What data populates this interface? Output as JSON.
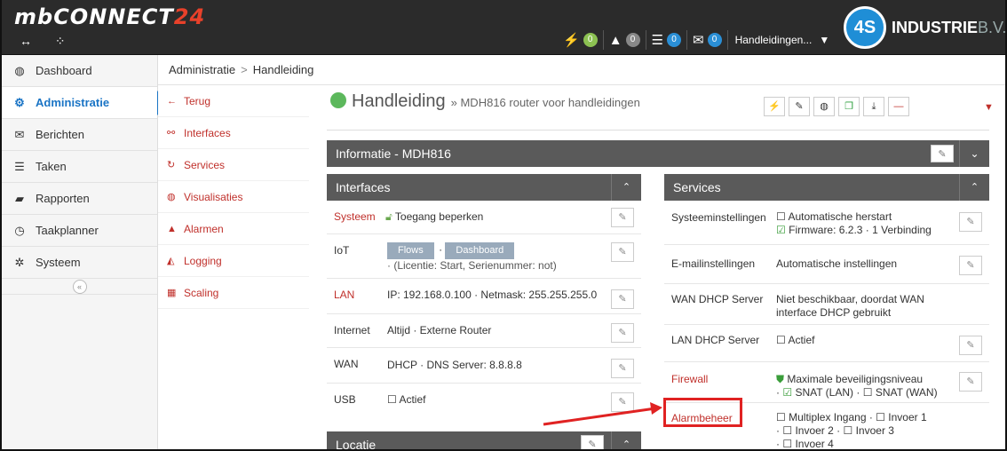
{
  "header": {
    "logo_main": "mbCONNECT",
    "logo_num": "24",
    "left_icons": [
      "arrows-icon",
      "spinner-icon"
    ],
    "badges": [
      {
        "icon": "bolt-icon",
        "glyph": "⚡",
        "count": "0",
        "color": "#8cc152"
      },
      {
        "icon": "warning-icon",
        "glyph": "▲",
        "count": "0",
        "color": "#888888"
      },
      {
        "icon": "server-icon",
        "glyph": "☰",
        "count": "0",
        "color": "#2a8fd6"
      },
      {
        "icon": "mail-icon",
        "glyph": "✉",
        "count": "0",
        "color": "#2a8fd6"
      }
    ],
    "user": "Handleidingen...",
    "brand_circle": "4S",
    "brand_name": "INDUSTRIE",
    "brand_suffix": "B.V."
  },
  "leftnav": {
    "items": [
      {
        "label": "Dashboard",
        "icon": "dashboard-icon",
        "glyph": "◍"
      },
      {
        "label": "Administratie",
        "icon": "cogs-icon",
        "glyph": "⚙"
      },
      {
        "label": "Berichten",
        "icon": "envelope-icon",
        "glyph": "✉"
      },
      {
        "label": "Taken",
        "icon": "server-icon",
        "glyph": "☰"
      },
      {
        "label": "Rapporten",
        "icon": "book-icon",
        "glyph": "▰"
      },
      {
        "label": "Taakplanner",
        "icon": "clock-icon",
        "glyph": "◷"
      },
      {
        "label": "Systeem",
        "icon": "gear-icon",
        "glyph": "✲"
      }
    ],
    "collapse": "«"
  },
  "breadcrumb": {
    "first": "Administratie",
    "sep": ">",
    "second": "Handleiding"
  },
  "subnav": {
    "items": [
      {
        "label": "Terug",
        "icon": "arrow-left-icon",
        "glyph": "←"
      },
      {
        "label": "Interfaces",
        "icon": "sitemap-icon",
        "glyph": "⚯"
      },
      {
        "label": "Services",
        "icon": "refresh-icon",
        "glyph": "↻"
      },
      {
        "label": "Visualisaties",
        "icon": "dashboard-icon",
        "glyph": "◍"
      },
      {
        "label": "Alarmen",
        "icon": "warning-icon",
        "glyph": "▲"
      },
      {
        "label": "Logging",
        "icon": "area-chart-icon",
        "glyph": "◭"
      },
      {
        "label": "Scaling",
        "icon": "calculator-icon",
        "glyph": "▦"
      }
    ]
  },
  "title": {
    "main": "Handleiding",
    "sub": "» MDH816 router voor handleidingen",
    "status_color": "#5cb85c"
  },
  "toolbar": {
    "buttons": [
      {
        "icon": "bolt-icon",
        "glyph": "⚡"
      },
      {
        "icon": "wrench-icon",
        "glyph": "✎"
      },
      {
        "icon": "dashboard-icon",
        "glyph": "◍"
      },
      {
        "icon": "copy-icon",
        "glyph": "❐"
      },
      {
        "icon": "download-icon",
        "glyph": "⤓"
      },
      {
        "icon": "minus-icon",
        "glyph": "—"
      }
    ],
    "caret": "▼"
  },
  "info_bar": {
    "title": "Informatie - MDH816"
  },
  "interfaces": {
    "title": "Interfaces",
    "rows": [
      {
        "key": "Systeem",
        "value": "Toegang beperken"
      },
      {
        "key": "IoT",
        "flows": "Flows",
        "dashboard": "Dashboard",
        "note": "· (Licentie: Start, Serienummer: not)"
      },
      {
        "key": "LAN",
        "value": "IP: 192.168.0.100   · Netmask: 255.255.255.0"
      },
      {
        "key": "Internet",
        "value": "Altijd   · Externe Router"
      },
      {
        "key": "WAN",
        "value": "DHCP   · DNS Server: 8.8.8.8"
      },
      {
        "key": "USB",
        "value": "Actief"
      }
    ]
  },
  "locatie": {
    "title": "Locatie"
  },
  "services": {
    "title": "Services",
    "rows": [
      {
        "key": "Systeeminstellingen",
        "line1": "Automatische herstart",
        "line2": "Firmware: 6.2.3   · 1 Verbinding"
      },
      {
        "key": "E-mailinstellingen",
        "line1": "Automatische instellingen"
      },
      {
        "key": "WAN DHCP Server",
        "line1": "Niet beschikbaar, doordat WAN",
        "line2": "interface DHCP gebruikt"
      },
      {
        "key": "LAN DHCP Server",
        "line1": "Actief"
      },
      {
        "key": "Firewall",
        "line1": "Maximale beveiligingsniveau",
        "line2a": "SNAT (LAN)",
        "line2b": "SNAT (WAN)"
      },
      {
        "key": "Alarmbeheer",
        "line1a": "Multiplex Ingang",
        "line1b": "Invoer 1",
        "line2a": "Invoer 2",
        "line2b": "Invoer 3",
        "line3": "Invoer 4"
      }
    ]
  },
  "colors": {
    "accent_red": "#c0302b",
    "nav_blue": "#1a74c5",
    "header_dark": "#2b2b2b",
    "annotation_red": "#e02222"
  }
}
